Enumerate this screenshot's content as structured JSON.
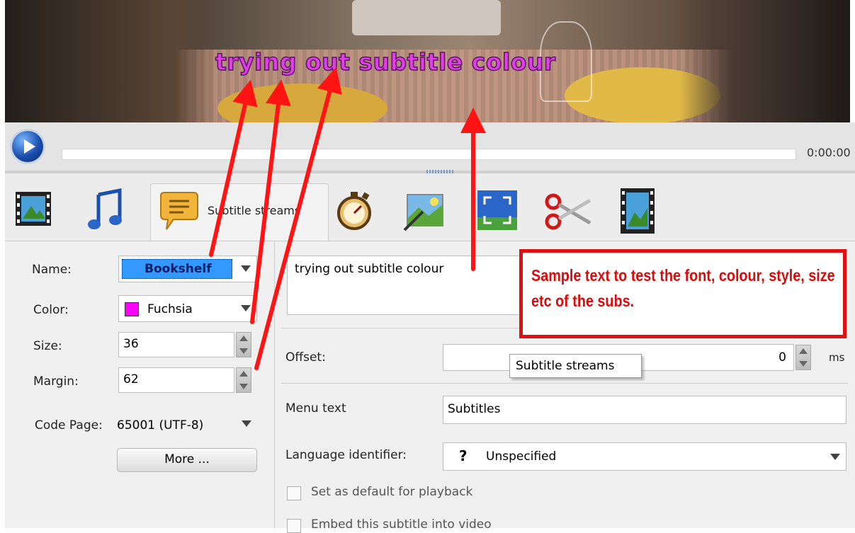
{
  "video": {
    "subtitle_text": "trying out subtitle colour"
  },
  "transport": {
    "play_icon": "play-icon",
    "time": "0:00:00"
  },
  "tabs": [
    {
      "icon": "film-icon",
      "label": ""
    },
    {
      "icon": "music-note-icon",
      "label": ""
    },
    {
      "icon": "speech-bubble-icon",
      "label": "Subtitle streams",
      "active": true
    },
    {
      "icon": "stopwatch-icon",
      "label": ""
    },
    {
      "icon": "image-wand-icon",
      "label": ""
    },
    {
      "icon": "crop-frame-icon",
      "label": ""
    },
    {
      "icon": "scissors-icon",
      "label": ""
    },
    {
      "icon": "film-effects-icon",
      "label": ""
    }
  ],
  "font_settings": {
    "name_label": "Name:",
    "name_value": "Bookshelf",
    "color_label": "Color:",
    "color_value": "Fuchsia",
    "color_swatch": "#ff00ff",
    "size_label": "Size:",
    "size_value": "36",
    "margin_label": "Margin:",
    "margin_value": "62",
    "codepage_label": "Code Page:",
    "codepage_value": "65001 (UTF-8)",
    "more_button": "More ..."
  },
  "subtitle_settings": {
    "sample_text": "trying out subtitle colour",
    "offset_label": "Offset:",
    "offset_value": "0",
    "offset_unit": "ms",
    "menu_text_label": "Menu text",
    "menu_text_value": "Subtitles",
    "language_label": "Language identifier:",
    "language_icon": "?",
    "language_value": "Unspecified",
    "default_playback_label": "Set as default for playback",
    "embed_label": "Embed this subtitle into video"
  },
  "annotation": {
    "text": "Sample text to test the font, colour, style, size etc of the subs.",
    "color": "#e01010"
  },
  "tooltip": {
    "text": "Subtitle streams"
  }
}
